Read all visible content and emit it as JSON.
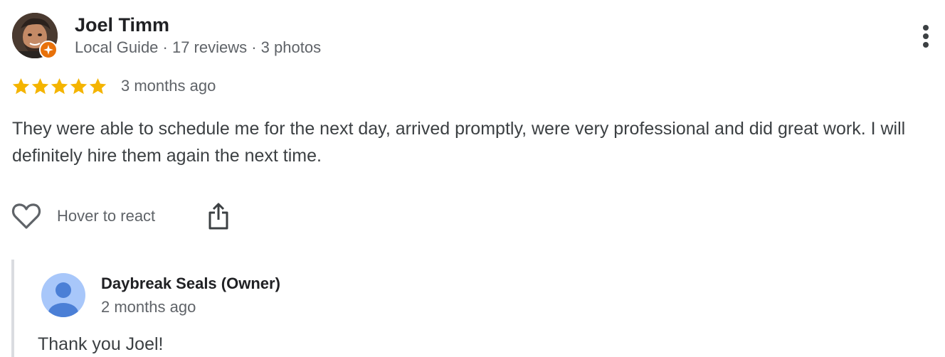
{
  "reviewer": {
    "name": "Joel Timm",
    "meta": "Local Guide · 17 reviews · 3 photos",
    "avatar_icon": "user-photo",
    "badge_icon": "local-guide-star-icon"
  },
  "rating": {
    "stars": 5,
    "max_stars": 5,
    "time_ago": "3 months ago",
    "star_color": "#f4b400"
  },
  "review": {
    "text": "They were able to schedule me for the next day, arrived promptly, were very professional and did great work. I will definitely hire them again the next time."
  },
  "actions": {
    "react_label": "Hover to react",
    "react_icon": "heart-outline-icon",
    "share_icon": "share-icon",
    "more_icon": "more-vertical-icon"
  },
  "owner_reply": {
    "name": "Daybreak Seals (Owner)",
    "time_ago": "2 months ago",
    "text": "Thank you Joel!",
    "avatar_icon": "default-person-icon",
    "avatar_color": "#a8c7fa",
    "avatar_figure_color": "#4b7fd6"
  }
}
